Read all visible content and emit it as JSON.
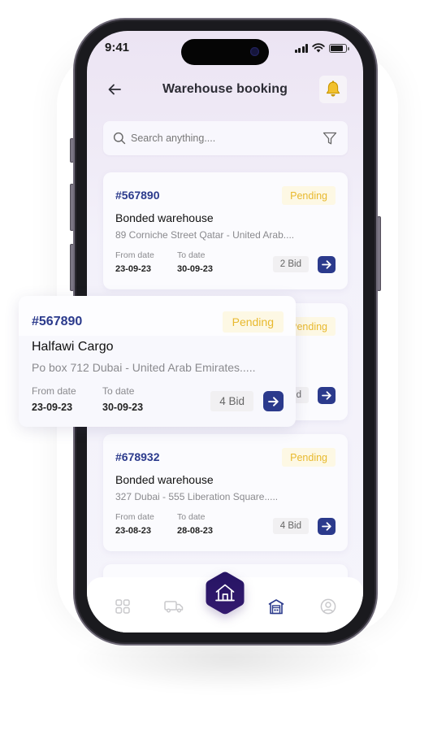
{
  "status_bar": {
    "time": "9:41"
  },
  "header": {
    "title": "Warehouse booking",
    "back_icon": "arrow-left-icon",
    "notification_icon": "bell-icon"
  },
  "search": {
    "placeholder": "Search anything....",
    "value": "",
    "search_icon": "search-icon",
    "filter_icon": "filter-icon"
  },
  "colors": {
    "primary": "#2b3a8c",
    "pending": "#e8b92e",
    "pending_bg": "#fdf8e4",
    "nav_center": "#2a1560"
  },
  "labels": {
    "from_date": "From date",
    "to_date": "To date"
  },
  "bookings": [
    {
      "id": "#567890",
      "status": "Pending",
      "name": "Bonded warehouse",
      "address": "89 Corniche Street Qatar - United Arab....",
      "from_date": "23-09-23",
      "to_date": "30-09-23",
      "bids": "2 Bid"
    },
    {
      "id": "#567890",
      "status": "Pending",
      "name": "",
      "address": "",
      "from_date": "",
      "to_date": "",
      "bids": "4 Bid"
    },
    {
      "id": "#678932",
      "status": "Pending",
      "name": "Bonded warehouse",
      "address": "327 Dubai - 555 Liberation Square.....",
      "from_date": "23-08-23",
      "to_date": "28-08-23",
      "bids": "4 Bid"
    }
  ],
  "featured_booking": {
    "id": "#567890",
    "status": "Pending",
    "name": "Halfawi Cargo",
    "address": "Po box 712 Dubai - United Arab Emirates.....",
    "from_date": "23-09-23",
    "to_date": "30-09-23",
    "bids": "4 Bid"
  },
  "bottom_nav": {
    "items": [
      {
        "name": "dashboard",
        "icon": "grid-icon",
        "active": false
      },
      {
        "name": "shipments",
        "icon": "truck-icon",
        "active": false
      },
      {
        "name": "home",
        "icon": "house-icon",
        "active": false
      },
      {
        "name": "warehouse",
        "icon": "warehouse-icon",
        "active": true
      },
      {
        "name": "profile",
        "icon": "user-circle-icon",
        "active": false
      }
    ]
  }
}
